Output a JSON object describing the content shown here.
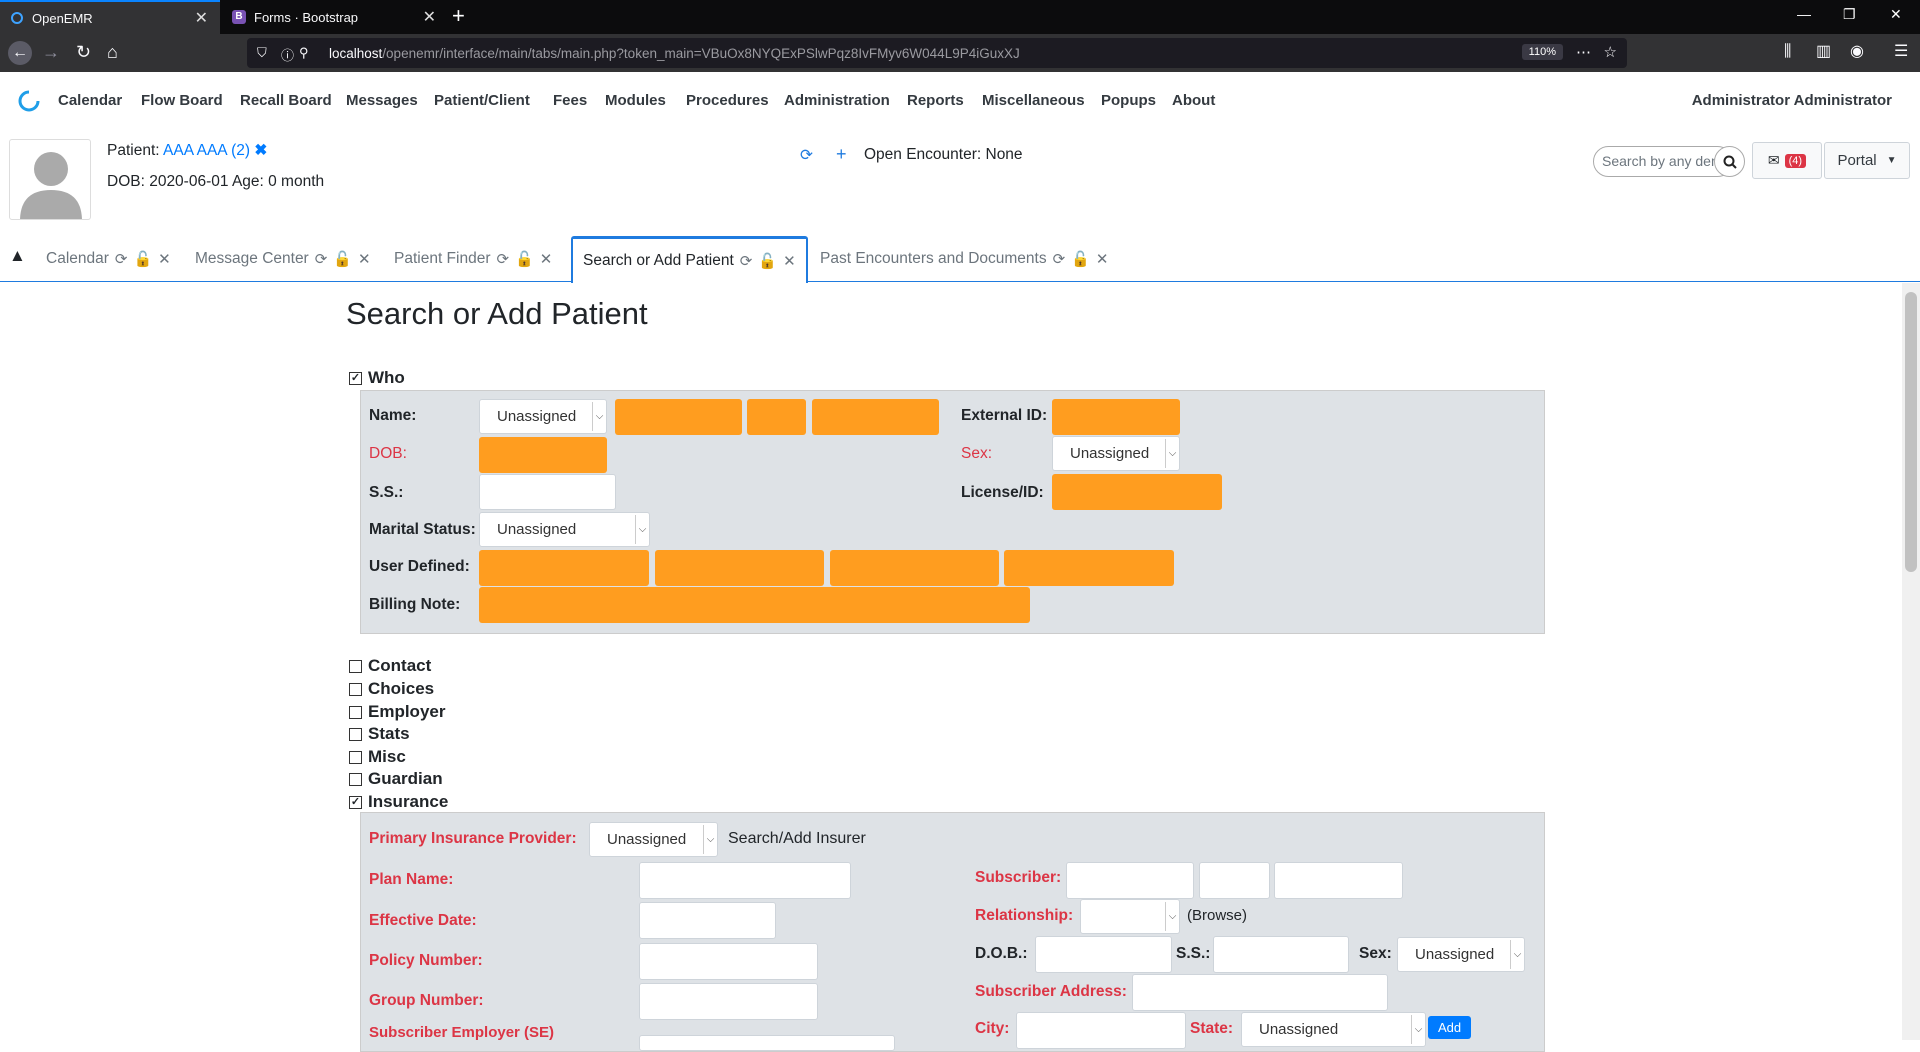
{
  "browser": {
    "tabs": [
      {
        "title": "OpenEMR"
      },
      {
        "title": "Forms · Bootstrap"
      }
    ],
    "url": {
      "host": "localhost",
      "path": "/openemr/interface/main/tabs/main.php?token_main=VBuOx8NYQExPSlwPqz8IvFMyv6W044L9P4iGuxXJ"
    },
    "zoom": "110%"
  },
  "menu": {
    "items": [
      "Calendar",
      "Flow Board",
      "Recall Board",
      "Messages",
      "Patient/Client",
      "Fees",
      "Modules",
      "Procedures",
      "Administration",
      "Reports",
      "Miscellaneous",
      "Popups",
      "About"
    ],
    "user": "Administrator Administrator"
  },
  "patient": {
    "label": "Patient:",
    "name": "AAA AAA (2)",
    "dob_line": "DOB: 2020-06-01 Age: 0 month",
    "encounter": "Open Encounter: None"
  },
  "header": {
    "search_placeholder": "Search by any demographics",
    "mail_badge": "(4)",
    "portal_label": "Portal"
  },
  "emr_tabs": [
    {
      "label": "Calendar"
    },
    {
      "label": "Message Center"
    },
    {
      "label": "Patient Finder"
    },
    {
      "label": "Search or Add Patient",
      "active": true
    },
    {
      "label": "Past Encounters and Documents"
    }
  ],
  "form": {
    "title": "Search or Add Patient",
    "who": {
      "section": "Who",
      "name_label": "Name:",
      "name_title": "Unassigned",
      "external_id_label": "External ID:",
      "dob_label": "DOB:",
      "sex_label": "Sex:",
      "sex_value": "Unassigned",
      "ss_label": "S.S.:",
      "license_label": "License/ID:",
      "marital_label": "Marital Status:",
      "marital_value": "Unassigned",
      "user_defined_label": "User Defined:",
      "billing_note_label": "Billing Note:"
    },
    "sections": [
      "Contact",
      "Choices",
      "Employer",
      "Stats",
      "Misc",
      "Guardian",
      "Insurance"
    ],
    "insurance": {
      "primary_provider_label": "Primary Insurance Provider:",
      "primary_provider_value": "Unassigned",
      "search_add_insurer": "Search/Add Insurer",
      "plan_name_label": "Plan Name:",
      "effective_date_label": "Effective Date:",
      "policy_number_label": "Policy Number:",
      "group_number_label": "Group Number:",
      "subscriber_employer_label": "Subscriber Employer (SE)",
      "subscriber_label": "Subscriber:",
      "relationship_label": "Relationship:",
      "browse_label": "(Browse)",
      "dob_label": "D.O.B.:",
      "ss_label": "S.S.:",
      "sex_label": "Sex:",
      "sex_value": "Unassigned",
      "subscriber_address_label": "Subscriber Address:",
      "city_label": "City:",
      "state_label": "State:",
      "state_value": "Unassigned",
      "add_label": "Add"
    }
  },
  "colors": {
    "required": "#dc3545",
    "highlight": "#ff9d1f",
    "accent": "#1f7bdf",
    "link": "#007bff"
  }
}
